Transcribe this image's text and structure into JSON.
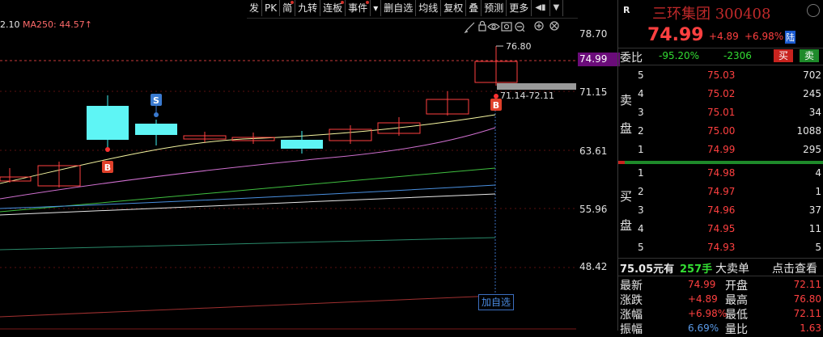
{
  "toolbar": {
    "items": [
      {
        "label": "发",
        "dot": false
      },
      {
        "label": "PK",
        "dot": false
      },
      {
        "label": "简",
        "dot": true
      },
      {
        "label": "九转",
        "dot": false
      },
      {
        "label": "连板",
        "dot": true
      },
      {
        "label": "事件",
        "dot": true
      },
      {
        "label": "▾",
        "dot": false
      },
      {
        "label": "删自选",
        "dot": false
      },
      {
        "label": "均线",
        "dot": false
      },
      {
        "label": "复权",
        "dot": false
      },
      {
        "label": "叠",
        "dot": false
      },
      {
        "label": "预测",
        "dot": false
      },
      {
        "label": "更多",
        "dot": false
      }
    ],
    "exit_icon": "exit-icon",
    "dropdown_icon": "chevron-down-icon"
  },
  "ma_line": {
    "prefix": "2.10",
    "ma250": "MA250: 44.57"
  },
  "chart_data": {
    "type": "candlestick",
    "y_ticks": [
      "78.70",
      "71.15",
      "63.61",
      "55.96",
      "48.42"
    ],
    "current_price_tag": "74.99",
    "high_label": "76.80",
    "range_label": "71.14-72.11",
    "markers": [
      "B",
      "S",
      "B"
    ],
    "candles_color_up": "#ff4040",
    "candles_color_down": "#40f0f0"
  },
  "chart_tools": [
    "brush-icon",
    "lock-icon",
    "eye-icon",
    "camera-icon",
    "zoom-out-icon",
    "zoom-in-icon",
    "close-icon"
  ],
  "add_watch": "加自选",
  "quote": {
    "r_label": "R",
    "name": "三环集团 300408",
    "price": "74.99",
    "change": "+4.89",
    "change_pct": "+6.98%",
    "exchange_badge": "陆",
    "weibi_label": "委比",
    "weibi": "-95.20%",
    "weicha": "-2306",
    "buy_btn": "买",
    "sell_btn": "卖",
    "sell_side": [
      "卖",
      "盘"
    ],
    "buy_side": [
      "买",
      "盘"
    ],
    "asks": [
      {
        "level": "5",
        "price": "75.03",
        "vol": "702"
      },
      {
        "level": "4",
        "price": "75.02",
        "vol": "245"
      },
      {
        "level": "3",
        "price": "75.01",
        "vol": "34"
      },
      {
        "level": "2",
        "price": "75.00",
        "vol": "1088"
      },
      {
        "level": "1",
        "price": "74.99",
        "vol": "295"
      }
    ],
    "bids": [
      {
        "level": "1",
        "price": "74.98",
        "vol": "4"
      },
      {
        "level": "2",
        "price": "74.97",
        "vol": "1"
      },
      {
        "level": "3",
        "price": "74.96",
        "vol": "37"
      },
      {
        "level": "4",
        "price": "74.95",
        "vol": "11"
      },
      {
        "level": "5",
        "price": "74.93",
        "vol": "5"
      }
    ],
    "big_order": {
      "price": "75.05元有",
      "qty": "257手",
      "type": "大卖单",
      "action": "点击查看"
    },
    "stats": [
      {
        "k1": "最新",
        "v1": "74.99",
        "k2": "开盘",
        "v2": "72.11"
      },
      {
        "k1": "涨跌",
        "v1": "+4.89",
        "k2": "最高",
        "v2": "76.80"
      },
      {
        "k1": "涨幅",
        "v1": "+6.98%",
        "k2": "最低",
        "v2": "72.11"
      },
      {
        "k1": "振幅",
        "v1": "6.69%",
        "k2": "量比",
        "v2": "1.63"
      }
    ]
  }
}
